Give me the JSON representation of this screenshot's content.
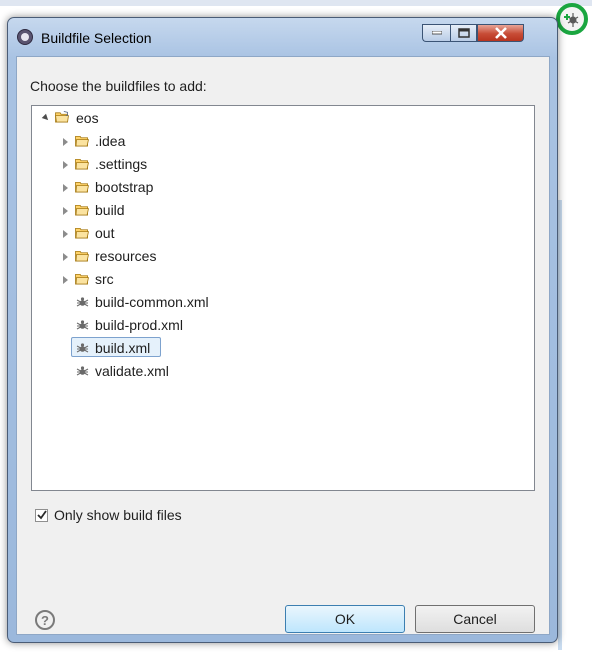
{
  "window": {
    "title": "Buildfile Selection"
  },
  "prompt": "Choose the buildfiles to add:",
  "tree": {
    "root": {
      "label": "eos",
      "expanded": true
    },
    "folders": [
      {
        "label": ".idea"
      },
      {
        "label": ".settings"
      },
      {
        "label": "bootstrap"
      },
      {
        "label": "build"
      },
      {
        "label": "out"
      },
      {
        "label": "resources"
      },
      {
        "label": "src"
      }
    ],
    "files": [
      {
        "label": "build-common.xml",
        "selected": false
      },
      {
        "label": "build-prod.xml",
        "selected": false
      },
      {
        "label": "build.xml",
        "selected": true
      },
      {
        "label": "validate.xml",
        "selected": false
      }
    ]
  },
  "only_show": {
    "label": "Only show build files",
    "checked": true
  },
  "buttons": {
    "ok": "OK",
    "cancel": "Cancel",
    "help": "?"
  },
  "colors": {
    "selection": "#e5f1fb",
    "accent_green": "#1aa640",
    "close_red": "#c74c36"
  }
}
